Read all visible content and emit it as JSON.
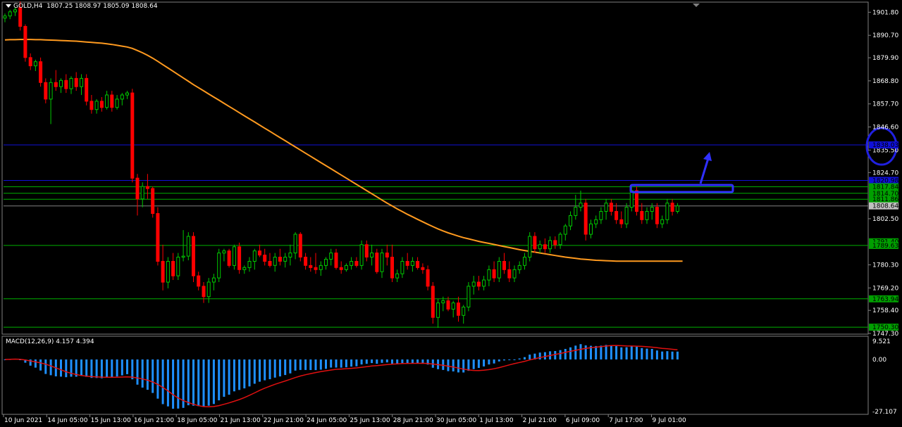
{
  "window": {
    "symbol_title": "GOLD,H4",
    "ohlc": "1807.25 1808.97 1805.09 1808.64"
  },
  "macd": {
    "title": "MACD(12,26,9) 4.157 4.394",
    "scale_labels": [
      "9.521",
      "0.00",
      "-27.107"
    ]
  },
  "colors": {
    "background": "#000000",
    "bull_candle": "#00c800",
    "bear_candle": "#ff0000",
    "moving_average": "#ff9a1f",
    "support_line": "#00b000",
    "resistance_line": "#1010d8",
    "annotation": "#3030ff",
    "macd_histogram": "#1e90ff",
    "macd_signal": "#e01010",
    "axis_text": "#ffffff"
  },
  "price_axis": {
    "labels": [
      "1901.80",
      "1890.70",
      "1879.90",
      "1868.80",
      "1857.70",
      "1846.60",
      "1835.50",
      "1824.70",
      "1802.50",
      "1780.30",
      "1769.20",
      "1758.40",
      "1747.30"
    ],
    "level_tags": [
      {
        "price": 1838.0,
        "text": "1838.03",
        "color": "#1010d8"
      },
      {
        "price": 1820.9,
        "text": "1820.98",
        "color": "#1010d8"
      },
      {
        "price": 1817.84,
        "text": "1817.84",
        "color": "#00a000"
      },
      {
        "price": 1814.7,
        "text": "1814.70",
        "color": "#00a000"
      },
      {
        "price": 1811.86,
        "text": "1811.86",
        "color": "#00a000"
      },
      {
        "price": 1808.64,
        "text": "1808.64",
        "color": "#c0c0c0"
      },
      {
        "price": 1791.4,
        "text": "1791.40",
        "color": "#00a000"
      },
      {
        "price": 1789.63,
        "text": "1789.63",
        "color": "#00a000"
      },
      {
        "price": 1763.94,
        "text": "1763.94",
        "color": "#00a000"
      },
      {
        "price": 1750.3,
        "text": "1750.30",
        "color": "#00a000"
      }
    ]
  },
  "time_axis": {
    "labels": [
      "10 Jun 2021",
      "14 Jun 05:00",
      "15 Jun 13:00",
      "16 Jun 21:00",
      "18 Jun 05:00",
      "21 Jun 13:00",
      "22 Jun 21:00",
      "24 Jun 05:00",
      "25 Jun 13:00",
      "28 Jun 21:00",
      "30 Jun 05:00",
      "1 Jul 13:00",
      "2 Jul 21:00",
      "6 Jul 09:00",
      "7 Jul 17:00",
      "9 Jul 01:00"
    ]
  },
  "chart_data": {
    "type": "candlestick",
    "symbol": "GOLD",
    "timeframe": "H4",
    "price_range": [
      1747.3,
      1906.0
    ],
    "candles": [
      [
        1899.0,
        1901.2,
        1897.0,
        1900.0
      ],
      [
        1900.0,
        1903.0,
        1898.5,
        1902.0
      ],
      [
        1902.0,
        1904.0,
        1900.0,
        1903.0
      ],
      [
        1904.0,
        1907.0,
        1893.0,
        1895.0
      ],
      [
        1895.0,
        1896.0,
        1878.0,
        1880.0
      ],
      [
        1880.0,
        1882.0,
        1874.0,
        1876.0
      ],
      [
        1876.0,
        1879.0,
        1873.5,
        1878.0
      ],
      [
        1878.0,
        1880.0,
        1866.0,
        1868.0
      ],
      [
        1868.0,
        1870.0,
        1858.0,
        1860.0
      ],
      [
        1860.0,
        1870.0,
        1848.0,
        1868.0
      ],
      [
        1868.0,
        1874.0,
        1864.0,
        1866.0
      ],
      [
        1866.0,
        1870.0,
        1863.0,
        1869.0
      ],
      [
        1869.0,
        1872.0,
        1863.0,
        1865.0
      ],
      [
        1865.0,
        1871.0,
        1862.5,
        1870.0
      ],
      [
        1870.0,
        1873.0,
        1864.0,
        1866.0
      ],
      [
        1866.0,
        1872.0,
        1862.0,
        1870.0
      ],
      [
        1870.0,
        1872.0,
        1857.0,
        1859.0
      ],
      [
        1859.0,
        1862.0,
        1853.0,
        1855.0
      ],
      [
        1855.0,
        1860.0,
        1853.0,
        1859.0
      ],
      [
        1859.0,
        1861.0,
        1854.0,
        1856.0
      ],
      [
        1856.0,
        1864.0,
        1855.0,
        1862.0
      ],
      [
        1862.0,
        1864.0,
        1854.0,
        1856.0
      ],
      [
        1856.0,
        1862.0,
        1855.0,
        1860.0
      ],
      [
        1860.0,
        1863.0,
        1857.0,
        1862.0
      ],
      [
        1862.0,
        1864.0,
        1860.0,
        1863.0
      ],
      [
        1863.0,
        1865.0,
        1820.0,
        1822.0
      ],
      [
        1822.0,
        1824.0,
        1804.0,
        1812.0
      ],
      [
        1812.0,
        1820.0,
        1808.0,
        1818.0
      ],
      [
        1818.0,
        1824.0,
        1812.0,
        1817.0
      ],
      [
        1817.0,
        1818.0,
        1803.0,
        1805.0
      ],
      [
        1805.0,
        1808.0,
        1780.0,
        1782.0
      ],
      [
        1782.0,
        1790.0,
        1768.0,
        1772.0
      ],
      [
        1772.0,
        1784.0,
        1769.0,
        1782.0
      ],
      [
        1782.0,
        1786.0,
        1773.0,
        1775.0
      ],
      [
        1775.0,
        1786.0,
        1773.0,
        1784.0
      ],
      [
        1784.0,
        1797.0,
        1782.0,
        1784.5
      ],
      [
        1784.5,
        1796.0,
        1782.5,
        1794.0
      ],
      [
        1794.0,
        1796.0,
        1772.0,
        1775.0
      ],
      [
        1775.0,
        1777.0,
        1768.0,
        1770.0
      ],
      [
        1770.0,
        1772.0,
        1762.0,
        1765.0
      ],
      [
        1765.0,
        1774.0,
        1762.0,
        1772.0
      ],
      [
        1772.0,
        1776.0,
        1768.0,
        1774.0
      ],
      [
        1774.0,
        1788.0,
        1772.0,
        1786.0
      ],
      [
        1786.0,
        1788.0,
        1782.0,
        1787.0
      ],
      [
        1787.0,
        1788.0,
        1779.0,
        1780.0
      ],
      [
        1780.0,
        1790.0,
        1778.0,
        1789.0
      ],
      [
        1789.0,
        1791.0,
        1776.0,
        1778.0
      ],
      [
        1778.0,
        1780.0,
        1776.0,
        1779.0
      ],
      [
        1779.0,
        1784.0,
        1777.0,
        1782.0
      ],
      [
        1782.0,
        1788.0,
        1778.0,
        1787.0
      ],
      [
        1787.0,
        1790.0,
        1784.0,
        1785.0
      ],
      [
        1785.0,
        1788.0,
        1780.0,
        1782.0
      ],
      [
        1782.0,
        1786.0,
        1779.0,
        1780.0
      ],
      [
        1780.0,
        1786.0,
        1777.0,
        1784.0
      ],
      [
        1784.0,
        1788.0,
        1780.0,
        1782.0
      ],
      [
        1782.0,
        1786.0,
        1779.0,
        1784.0
      ],
      [
        1784.0,
        1790.0,
        1780.0,
        1786.0
      ],
      [
        1786.0,
        1796.0,
        1783.0,
        1795.0
      ],
      [
        1795.0,
        1796.0,
        1782.0,
        1784.0
      ],
      [
        1784.0,
        1786.0,
        1778.0,
        1780.0
      ],
      [
        1780.0,
        1784.0,
        1777.0,
        1779.0
      ],
      [
        1779.0,
        1786.0,
        1776.0,
        1778.0
      ],
      [
        1778.0,
        1782.0,
        1775.0,
        1780.0
      ],
      [
        1780.0,
        1784.0,
        1778.0,
        1783.0
      ],
      [
        1783.0,
        1788.0,
        1780.0,
        1786.0
      ],
      [
        1786.0,
        1788.0,
        1778.0,
        1779.0
      ],
      [
        1779.0,
        1782.0,
        1776.0,
        1778.0
      ],
      [
        1778.0,
        1781.0,
        1777.0,
        1780.0
      ],
      [
        1780.0,
        1784.0,
        1778.0,
        1782.0
      ],
      [
        1782.0,
        1784.0,
        1779.0,
        1780.0
      ],
      [
        1780.0,
        1792.0,
        1778.0,
        1790.0
      ],
      [
        1790.0,
        1792.0,
        1782.0,
        1784.0
      ],
      [
        1784.0,
        1790.0,
        1780.0,
        1786.0
      ],
      [
        1786.0,
        1788.0,
        1776.0,
        1777.0
      ],
      [
        1777.0,
        1788.0,
        1774.0,
        1786.0
      ],
      [
        1786.0,
        1790.0,
        1780.0,
        1784.0
      ],
      [
        1784.0,
        1790.0,
        1772.0,
        1774.0
      ],
      [
        1774.0,
        1778.0,
        1772.0,
        1776.0
      ],
      [
        1776.0,
        1784.0,
        1774.0,
        1782.0
      ],
      [
        1782.0,
        1786.0,
        1778.0,
        1780.0
      ],
      [
        1780.0,
        1784.0,
        1777.0,
        1782.0
      ],
      [
        1782.0,
        1784.0,
        1778.0,
        1779.0
      ],
      [
        1779.0,
        1781.0,
        1776.0,
        1778.0
      ],
      [
        1778.0,
        1780.0,
        1768.0,
        1770.0
      ],
      [
        1770.0,
        1772.0,
        1752.0,
        1755.0
      ],
      [
        1755.0,
        1764.0,
        1750.0,
        1762.0
      ],
      [
        1762.0,
        1765.0,
        1758.0,
        1763.0
      ],
      [
        1763.0,
        1765.0,
        1758.0,
        1759.0
      ],
      [
        1759.0,
        1763.0,
        1755.0,
        1762.0
      ],
      [
        1762.0,
        1765.0,
        1753.0,
        1756.0
      ],
      [
        1756.0,
        1761.0,
        1752.0,
        1760.0
      ],
      [
        1760.0,
        1772.0,
        1758.0,
        1770.0
      ],
      [
        1770.0,
        1775.0,
        1766.0,
        1772.0
      ],
      [
        1772.0,
        1775.0,
        1768.0,
        1770.0
      ],
      [
        1770.0,
        1775.0,
        1768.0,
        1773.0
      ],
      [
        1773.0,
        1780.0,
        1770.0,
        1778.0
      ],
      [
        1778.0,
        1782.0,
        1772.0,
        1774.0
      ],
      [
        1774.0,
        1784.0,
        1772.0,
        1782.0
      ],
      [
        1782.0,
        1786.0,
        1776.0,
        1778.0
      ],
      [
        1778.0,
        1782.0,
        1772.0,
        1774.0
      ],
      [
        1774.0,
        1780.0,
        1772.0,
        1778.0
      ],
      [
        1778.0,
        1782.0,
        1776.0,
        1780.0
      ],
      [
        1780.0,
        1786.0,
        1778.0,
        1784.0
      ],
      [
        1784.0,
        1796.0,
        1782.0,
        1794.0
      ],
      [
        1794.0,
        1796.0,
        1786.0,
        1788.0
      ],
      [
        1788.0,
        1792.0,
        1786.0,
        1790.0
      ],
      [
        1790.0,
        1793.0,
        1786.0,
        1788.0
      ],
      [
        1788.0,
        1794.0,
        1786.0,
        1792.0
      ],
      [
        1792.0,
        1794.0,
        1788.0,
        1790.0
      ],
      [
        1790.0,
        1796.0,
        1788.0,
        1795.0
      ],
      [
        1795.0,
        1800.0,
        1792.0,
        1799.0
      ],
      [
        1799.0,
        1806.0,
        1797.0,
        1804.0
      ],
      [
        1804.0,
        1814.0,
        1802.0,
        1808.0
      ],
      [
        1808.0,
        1816.0,
        1806.0,
        1810.0
      ],
      [
        1810.0,
        1812.0,
        1792.0,
        1795.0
      ],
      [
        1795.0,
        1802.0,
        1793.0,
        1800.0
      ],
      [
        1800.0,
        1804.0,
        1798.0,
        1802.0
      ],
      [
        1802.0,
        1808.0,
        1800.0,
        1806.0
      ],
      [
        1806.0,
        1812.0,
        1802.0,
        1810.0
      ],
      [
        1810.0,
        1812.0,
        1804.0,
        1806.0
      ],
      [
        1806.0,
        1810.0,
        1800.0,
        1802.0
      ],
      [
        1802.0,
        1806.0,
        1798.0,
        1800.0
      ],
      [
        1800.0,
        1810.0,
        1798.0,
        1808.0
      ],
      [
        1808.0,
        1818.0,
        1806.0,
        1816.0
      ],
      [
        1816.0,
        1818.0,
        1804.0,
        1806.0
      ],
      [
        1806.0,
        1810.0,
        1800.0,
        1802.0
      ],
      [
        1802.0,
        1808.0,
        1800.0,
        1806.0
      ],
      [
        1806.0,
        1810.0,
        1802.0,
        1808.0
      ],
      [
        1808.0,
        1810.0,
        1798.0,
        1800.0
      ],
      [
        1800.0,
        1804.0,
        1798.0,
        1802.0
      ],
      [
        1802.0,
        1812.0,
        1800.0,
        1810.0
      ],
      [
        1810.0,
        1812.0,
        1804.0,
        1806.0
      ],
      [
        1806.0,
        1810.0,
        1805.0,
        1808.64
      ]
    ],
    "moving_average": {
      "color": "#ff9a1f",
      "values": [
        1888.5,
        1888.6,
        1888.6,
        1888.7,
        1888.7,
        1888.7,
        1888.6,
        1888.6,
        1888.5,
        1888.4,
        1888.3,
        1888.2,
        1888.1,
        1888.0,
        1887.9,
        1887.7,
        1887.5,
        1887.3,
        1887.1,
        1886.9,
        1886.6,
        1886.3,
        1885.9,
        1885.5,
        1885.1,
        1884.4,
        1883.4,
        1882.3,
        1881.1,
        1879.7,
        1878.2,
        1876.6,
        1875.0,
        1873.4,
        1871.8,
        1870.2,
        1868.6,
        1867.0,
        1865.5,
        1864.0,
        1862.5,
        1861.0,
        1859.5,
        1858.0,
        1856.5,
        1855.0,
        1853.5,
        1852.0,
        1850.5,
        1849.0,
        1847.5,
        1846.0,
        1844.5,
        1843.0,
        1841.5,
        1840.0,
        1838.5,
        1837.0,
        1835.5,
        1834.0,
        1832.5,
        1831.0,
        1829.5,
        1828.0,
        1826.5,
        1825.0,
        1823.5,
        1822.0,
        1820.5,
        1819.0,
        1817.5,
        1816.0,
        1814.5,
        1813.0,
        1811.5,
        1810.0,
        1808.6,
        1807.2,
        1805.9,
        1804.6,
        1803.4,
        1802.2,
        1801.0,
        1799.8,
        1798.7,
        1797.6,
        1796.6,
        1795.7,
        1794.9,
        1794.1,
        1793.4,
        1792.8,
        1792.2,
        1791.6,
        1791.1,
        1790.6,
        1790.1,
        1789.6,
        1789.1,
        1788.6,
        1788.1,
        1787.6,
        1787.2,
        1786.8,
        1786.4,
        1786.0,
        1785.6,
        1785.2,
        1784.8,
        1784.4,
        1784.0,
        1783.7,
        1783.4,
        1783.1,
        1782.9,
        1782.7,
        1782.5,
        1782.4,
        1782.3,
        1782.2,
        1782.1,
        1782.1,
        1782.1,
        1782.1,
        1782.1,
        1782.1,
        1782.1,
        1782.1,
        1782.1,
        1782.1,
        1782.1,
        1782.1,
        1782.1,
        1782.1
      ]
    },
    "horizontal_levels": [
      {
        "price": 1838.0,
        "color": "#1010d8"
      },
      {
        "price": 1820.9,
        "color": "#1010d8"
      },
      {
        "price": 1817.84,
        "color": "#00b000"
      },
      {
        "price": 1814.7,
        "color": "#00b000"
      },
      {
        "price": 1811.86,
        "color": "#00b000"
      },
      {
        "price": 1808.64,
        "color": "#808080"
      },
      {
        "price": 1789.63,
        "color": "#00b000"
      },
      {
        "price": 1763.94,
        "color": "#00b000"
      },
      {
        "price": 1750.3,
        "color": "#00b000"
      }
    ],
    "macd": {
      "fast": 12,
      "slow": 26,
      "signal": 9,
      "current_main": 4.157,
      "current_signal": 4.394,
      "range": [
        -27.107,
        9.521
      ]
    }
  }
}
